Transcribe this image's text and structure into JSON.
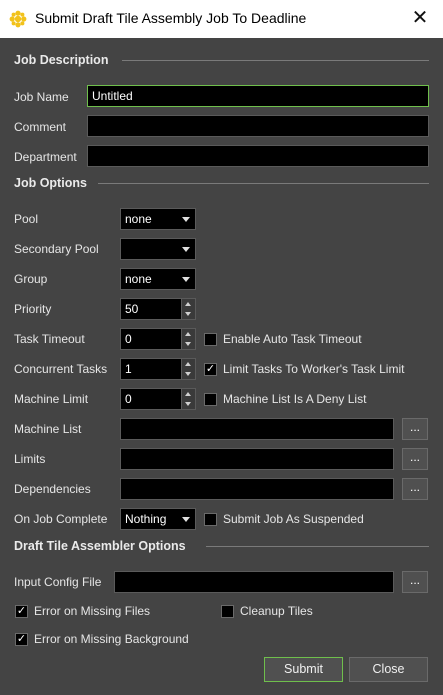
{
  "window": {
    "title": "Submit Draft Tile Assembly Job To Deadline",
    "close_glyph": "✕",
    "icon": "deadline-app-icon"
  },
  "sections": {
    "job_description": "Job Description",
    "job_options": "Job Options",
    "draft_tile": "Draft Tile Assembler Options"
  },
  "job_description": {
    "job_name_label": "Job Name",
    "job_name_value": "Untitled",
    "comment_label": "Comment",
    "comment_value": "",
    "department_label": "Department",
    "department_value": ""
  },
  "job_options": {
    "pool_label": "Pool",
    "pool_value": "none",
    "secondary_pool_label": "Secondary Pool",
    "secondary_pool_value": "",
    "group_label": "Group",
    "group_value": "none",
    "priority_label": "Priority",
    "priority_value": "50",
    "task_timeout_label": "Task Timeout",
    "task_timeout_value": "0",
    "auto_timeout_label": "Enable Auto Task Timeout",
    "concurrent_label": "Concurrent Tasks",
    "concurrent_value": "1",
    "limit_tasks_label": "Limit Tasks To Worker's Task Limit",
    "machine_limit_label": "Machine Limit",
    "machine_limit_value": "0",
    "deny_list_label": "Machine List Is A Deny List",
    "machine_list_label": "Machine List",
    "machine_list_value": "",
    "limits_label": "Limits",
    "limits_value": "",
    "dependencies_label": "Dependencies",
    "dependencies_value": "",
    "on_complete_label": "On Job Complete",
    "on_complete_value": "Nothing",
    "suspended_label": "Submit Job As Suspended",
    "browse_label": "...",
    "checks": {
      "auto_timeout": false,
      "limit_tasks": true,
      "deny_list": false,
      "suspended": false
    }
  },
  "draft": {
    "input_config_label": "Input Config File",
    "input_config_value": "",
    "missing_files_label": "Error on Missing Files",
    "cleanup_label": "Cleanup Tiles",
    "missing_bg_label": "Error on Missing Background",
    "checks": {
      "missing_files": true,
      "cleanup": false,
      "missing_bg": true
    }
  },
  "buttons": {
    "submit": "Submit",
    "close": "Close"
  },
  "check_glyph": "✓",
  "colors": {
    "background": "#444444",
    "field": "#000000",
    "focus_border": "#6fbf4c"
  }
}
